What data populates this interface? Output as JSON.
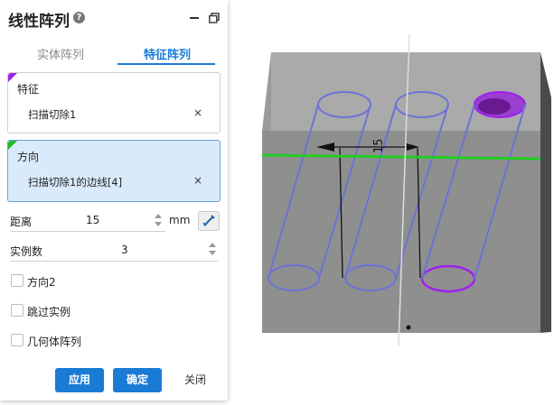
{
  "panel": {
    "title": "线性阵列",
    "help_icon": "?",
    "tabs": [
      {
        "label": "实体阵列",
        "active": false
      },
      {
        "label": "特征阵列",
        "active": true
      }
    ],
    "feature_box": {
      "label": "特征",
      "value": "扫描切除1",
      "clear": "×",
      "marker_color": "#a020f0"
    },
    "direction_box": {
      "label": "方向",
      "value": "扫描切除1的边线[4]",
      "clear": "×",
      "marker_color": "#22bb22"
    },
    "distance": {
      "label": "距离",
      "value": "15",
      "unit": "mm"
    },
    "instances": {
      "label": "实例数",
      "value": "3"
    },
    "checkboxes": [
      {
        "label": "方向2",
        "checked": false
      },
      {
        "label": "跳过实例",
        "checked": false
      },
      {
        "label": "几何体阵列",
        "checked": false
      }
    ],
    "buttons": {
      "apply": "应用",
      "ok": "确定",
      "close": "关闭"
    }
  },
  "viewport": {
    "dimension_label": "15",
    "colors": {
      "block_top": "#aaaaaa",
      "block_front": "#8e8e8e",
      "block_side": "#4a4a4a",
      "edge_highlight": "#22cc22",
      "cylinder": "#6b73d6",
      "selected_feature": "#a020f0"
    }
  }
}
